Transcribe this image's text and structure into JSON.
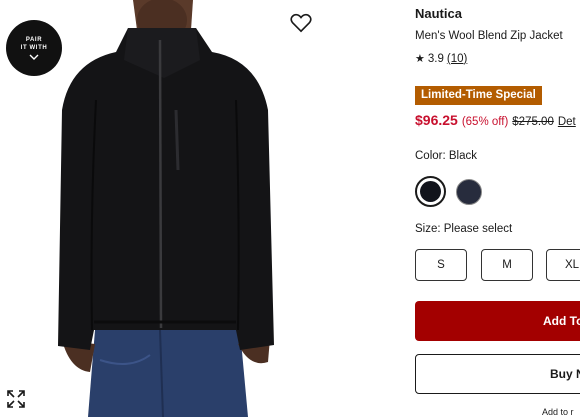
{
  "product": {
    "brand": "Nautica",
    "name": "Men's Wool Blend Zip Jacket",
    "rating": "3.9",
    "review_count": "(10)",
    "star_icon": "star-icon"
  },
  "badges": {
    "pair_line1": "PAIR",
    "pair_line2": "IT WITH",
    "promo": "Limited-Time Special"
  },
  "pricing": {
    "sale_price": "$96.25",
    "discount": "(65% off)",
    "original_price": "$275.00",
    "details_link": "Det"
  },
  "color": {
    "label": "Color: Black",
    "swatches": [
      {
        "name": "Black",
        "hex": "#12141c",
        "selected": true
      },
      {
        "name": "Navy",
        "hex": "#272c3d",
        "selected": false
      }
    ]
  },
  "size": {
    "label": "Size: Please select",
    "options": [
      "S",
      "M",
      "XL"
    ]
  },
  "actions": {
    "add_to_bag": "Add To",
    "buy_now": "Buy N",
    "add_to_list": "Add to r"
  },
  "colors": {
    "sale_red": "#c8102e",
    "promo_bg": "#b35c00",
    "add_button_bg": "#a30000"
  },
  "icons": [
    "heart-icon",
    "chevron-down-icon",
    "expand-icon",
    "star-icon"
  ]
}
